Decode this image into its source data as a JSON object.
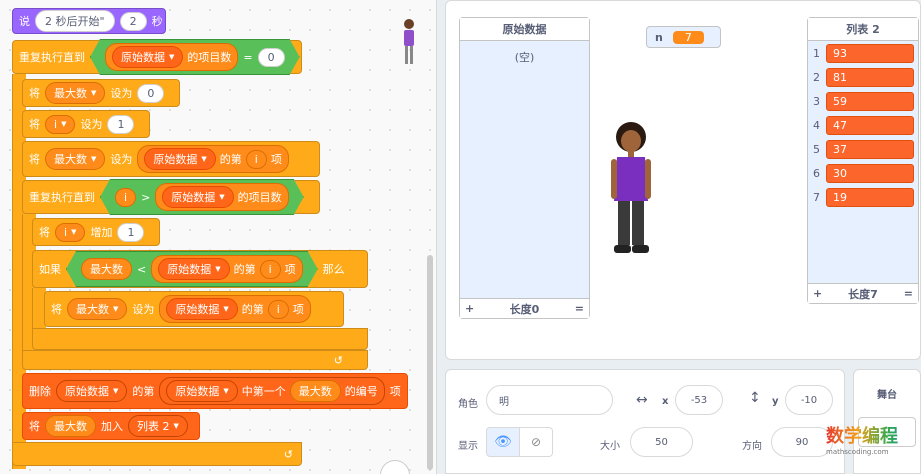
{
  "code": {
    "say": {
      "label": "说",
      "text": "2 秒后开始\"",
      "secs": "2",
      "unit": "秒"
    },
    "repeat_until1": {
      "label": "重复执行直到",
      "list": "原始数据",
      "prop": "的项目数",
      "op": "=",
      "val": "0"
    },
    "set_max": {
      "label": "将",
      "var": "最大数",
      "set": "设为",
      "val": "0"
    },
    "set_i": {
      "label": "将",
      "var": "i",
      "set": "设为",
      "val": "1"
    },
    "set_max2": {
      "label": "将",
      "var": "最大数",
      "set": "设为",
      "list": "原始数据",
      "of": "的第",
      "idx": "i",
      "item": "项"
    },
    "repeat_until2": {
      "label": "重复执行直到",
      "var": "i",
      "op": ">",
      "list": "原始数据",
      "prop": "的项目数"
    },
    "change_i": {
      "label": "将",
      "var": "i",
      "change": "增加",
      "val": "1"
    },
    "if": {
      "label": "如果",
      "var": "最大数",
      "op": "<",
      "list": "原始数据",
      "of": "的第",
      "idx": "i",
      "item": "项",
      "then": "那么"
    },
    "set_max3": {
      "label": "将",
      "var": "最大数",
      "set": "设为",
      "list": "原始数据",
      "of": "的第",
      "idx": "i",
      "item": "项"
    },
    "delete": {
      "label": "删除",
      "list": "原始数据",
      "of": "的第",
      "list2": "原始数据",
      "first": "中第一个",
      "var": "最大数",
      "idx": "的编号",
      "item": "项"
    },
    "add": {
      "label": "将",
      "var": "最大数",
      "add": "加入",
      "list": "列表 2"
    },
    "loop_icon": "↺"
  },
  "stage": {
    "mon1": {
      "title": "原始数据",
      "empty": "(空)",
      "plus": "+",
      "len": "长度0",
      "eq": "="
    },
    "n_monitor": {
      "name": "n",
      "value": "7"
    },
    "mon2": {
      "title": "列表 2",
      "items": [
        "93",
        "81",
        "59",
        "47",
        "37",
        "30",
        "19"
      ],
      "plus": "+",
      "len": "长度7",
      "eq": "="
    }
  },
  "sprite_panel": {
    "sprite_label": "角色",
    "sprite_name": "明",
    "x_label": "x",
    "x": "-53",
    "y_label": "y",
    "y": "-10",
    "show_label": "显示",
    "size_label": "大小",
    "size": "50",
    "dir_label": "方向",
    "dir": "90"
  },
  "stage_panel": {
    "label": "舞台"
  },
  "watermark": {
    "line1": "数学编程",
    "line2": "mathscoding.com"
  }
}
